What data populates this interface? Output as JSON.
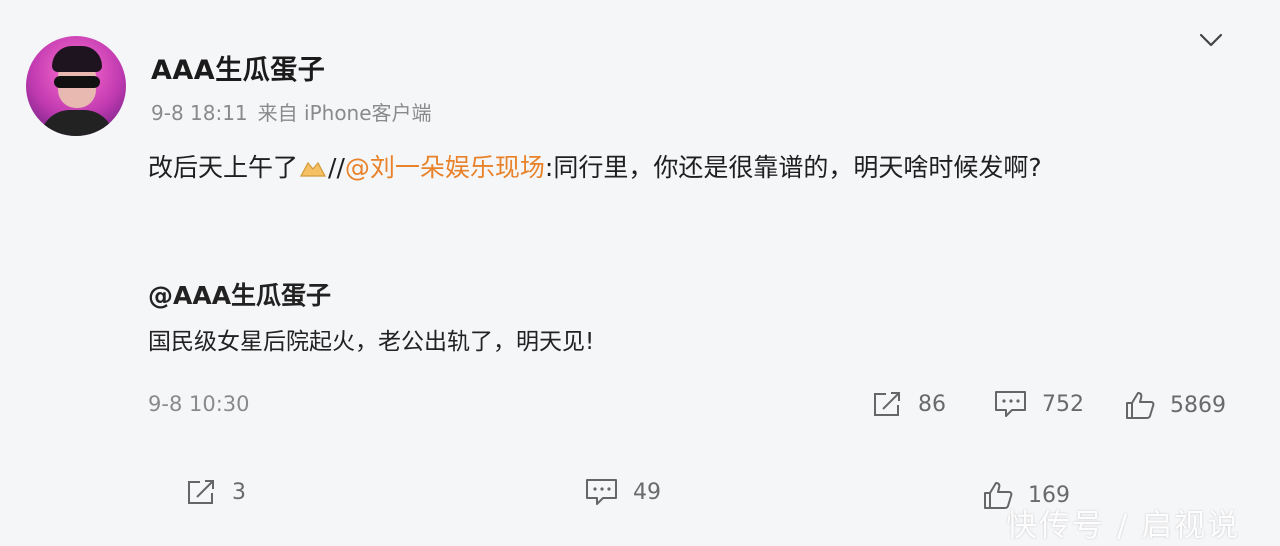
{
  "post": {
    "username": "AAA生瓜蛋子",
    "time": "9-8 18:11",
    "source": "来自 iPhone客户端",
    "text_prefix": "改后天上午了",
    "text_separator": "//",
    "mention": "@刘一朵娱乐现场",
    "text_suffix": ":同行里，你还是很靠谱的，明天啥时候发啊?"
  },
  "repost": {
    "user": "@AAA生瓜蛋子",
    "text": "国民级女星后院起火，老公出轨了，明天见!",
    "time": "9-8 10:30",
    "share_count": "86",
    "comment_count": "752",
    "like_count": "5869"
  },
  "footer": {
    "share_count": "3",
    "comment_count": "49",
    "like_count": "169"
  },
  "watermark": "快传号 / 启视说",
  "colors": {
    "mention": "#e8832b",
    "meta_gray": "#8a8a8a",
    "background": "#f5f6f8"
  },
  "icons": [
    "chevron-down-icon",
    "share-icon",
    "comment-icon",
    "like-icon"
  ]
}
